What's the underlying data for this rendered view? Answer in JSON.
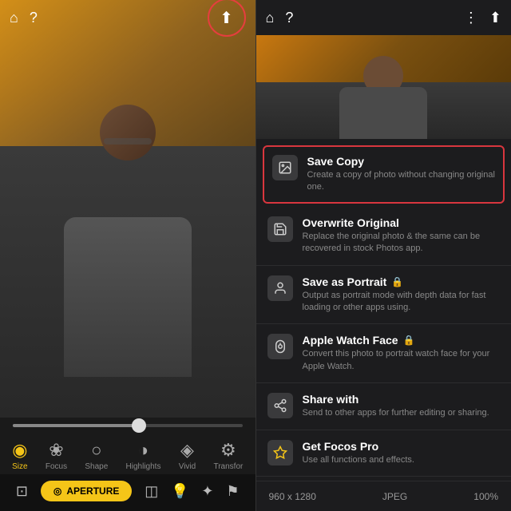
{
  "left": {
    "top_icons": {
      "home": "⌂",
      "help": "?",
      "upload": "⬆"
    },
    "slider": {
      "value": 55
    },
    "tools": [
      {
        "id": "size",
        "icon": "◎",
        "label": "Size",
        "active": true
      },
      {
        "id": "focus",
        "icon": "❋",
        "label": "Focus",
        "active": false
      },
      {
        "id": "shape",
        "icon": "○",
        "label": "Shape",
        "active": false
      },
      {
        "id": "highlights",
        "icon": "◑",
        "label": "Highlights",
        "active": false
      },
      {
        "id": "vivid",
        "icon": "◇",
        "label": "Vivid",
        "active": false
      },
      {
        "id": "transform",
        "icon": "⚙",
        "label": "Transfor",
        "active": false
      }
    ],
    "bottom_tools": [
      {
        "id": "crop",
        "icon": "⊡"
      },
      {
        "id": "aperture",
        "label": "APERTURE"
      },
      {
        "id": "compare",
        "icon": "◫"
      },
      {
        "id": "light",
        "icon": "💡"
      },
      {
        "id": "magic",
        "icon": "✦"
      },
      {
        "id": "flag",
        "icon": "⚑"
      }
    ]
  },
  "right": {
    "top_icons": {
      "home": "⌂",
      "help": "?",
      "more": "⋮",
      "upload": "⬆"
    },
    "menu_items": [
      {
        "id": "save-copy",
        "icon": "🖼",
        "title": "Save Copy",
        "desc": "Create a copy of photo without changing original one.",
        "highlighted": true,
        "locked": false
      },
      {
        "id": "overwrite-original",
        "icon": "💾",
        "title": "Overwrite Original",
        "desc": "Replace the original photo & the same can be recovered in stock Photos app.",
        "highlighted": false,
        "locked": false
      },
      {
        "id": "save-as-portrait",
        "icon": "👤",
        "title": "Save as Portrait",
        "desc": "Output as portrait mode with depth data for fast loading or other apps using.",
        "highlighted": false,
        "locked": true
      },
      {
        "id": "apple-watch-face",
        "icon": "⌚",
        "title": "Apple Watch Face",
        "desc": "Convert this photo to portrait watch face for your Apple Watch.",
        "highlighted": false,
        "locked": true
      },
      {
        "id": "share-with",
        "icon": "↗",
        "title": "Share with",
        "desc": "Send to other apps for further editing or sharing.",
        "highlighted": false,
        "locked": false
      },
      {
        "id": "get-focos-pro",
        "icon": "👑",
        "title": "Get Focos Pro",
        "desc": "Use all functions and effects.",
        "highlighted": false,
        "locked": false
      }
    ],
    "bottom_bar": {
      "resolution": "960 x 1280",
      "format": "JPEG",
      "zoom": "100%"
    }
  }
}
